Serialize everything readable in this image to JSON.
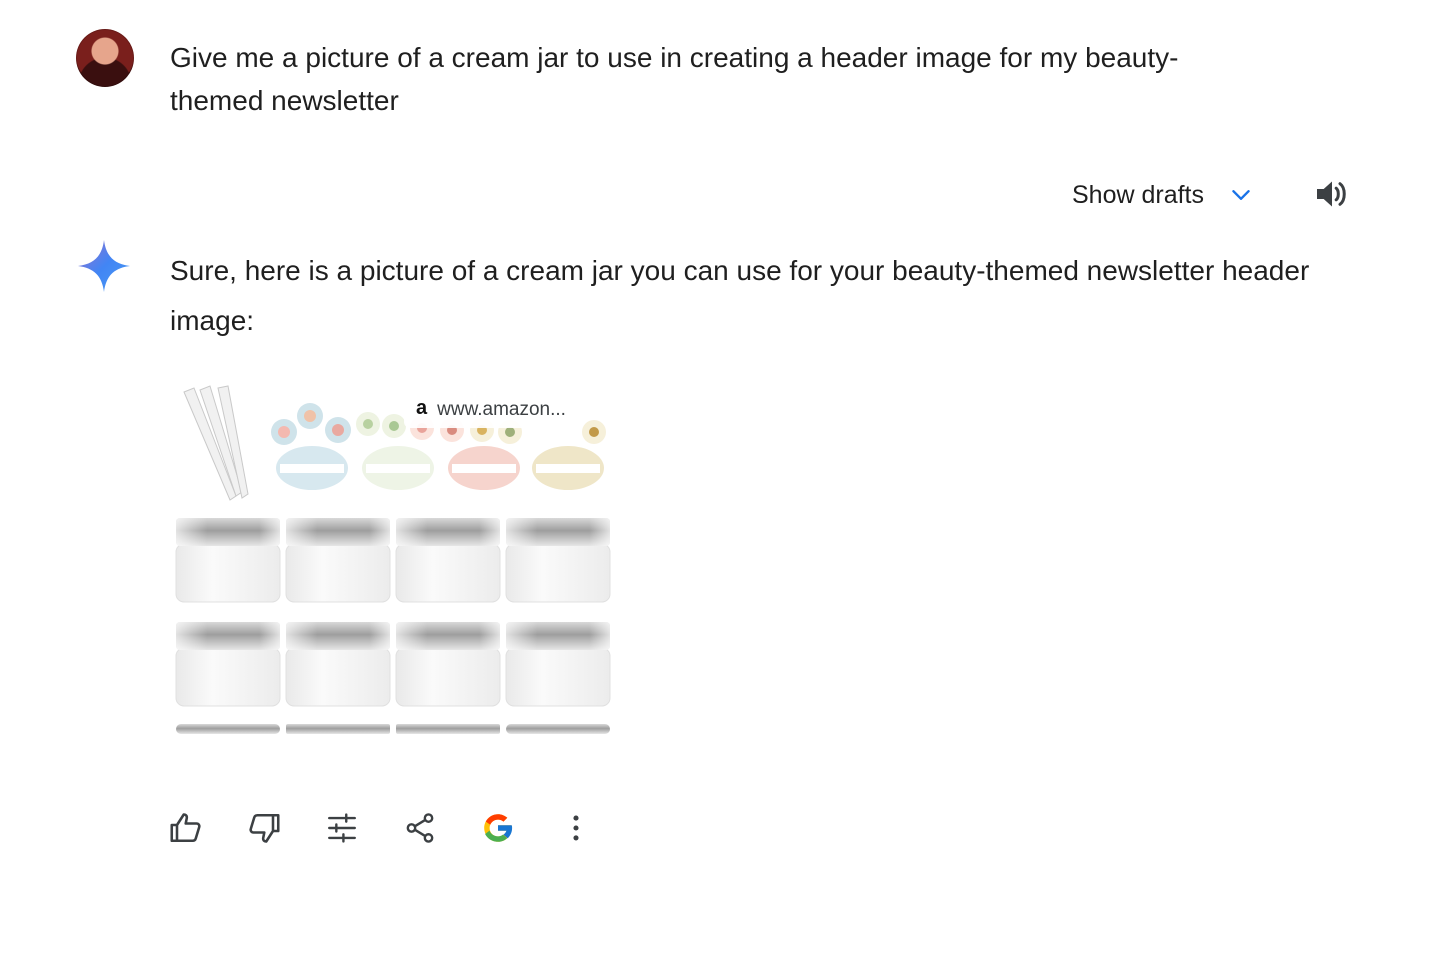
{
  "user_message": {
    "avatar_icon": "user-avatar",
    "text": "Give me a picture of a cream jar to use in creating a header image for my beauty-themed newsletter"
  },
  "drafts": {
    "label": "Show drafts",
    "chevron_icon": "chevron-down-icon",
    "chevron_color": "#1a73e8"
  },
  "speaker_icon": "volume-up-icon",
  "assistant": {
    "icon": "gemini-sparkle-icon",
    "text": "Sure, here is a picture of a cream jar you can use for your beauty-themed newsletter header image:",
    "image": {
      "description_icon": "cream-jars-product-image",
      "source_logo": "a",
      "source_text": "www.amazon..."
    }
  },
  "actions": [
    {
      "name": "thumbs-up",
      "icon": "thumbs-up-icon"
    },
    {
      "name": "thumbs-down",
      "icon": "thumbs-down-icon"
    },
    {
      "name": "modify-response",
      "icon": "tune-icon"
    },
    {
      "name": "share",
      "icon": "share-icon"
    },
    {
      "name": "google-it",
      "icon": "google-g-icon"
    },
    {
      "name": "more",
      "icon": "more-vertical-icon"
    }
  ]
}
